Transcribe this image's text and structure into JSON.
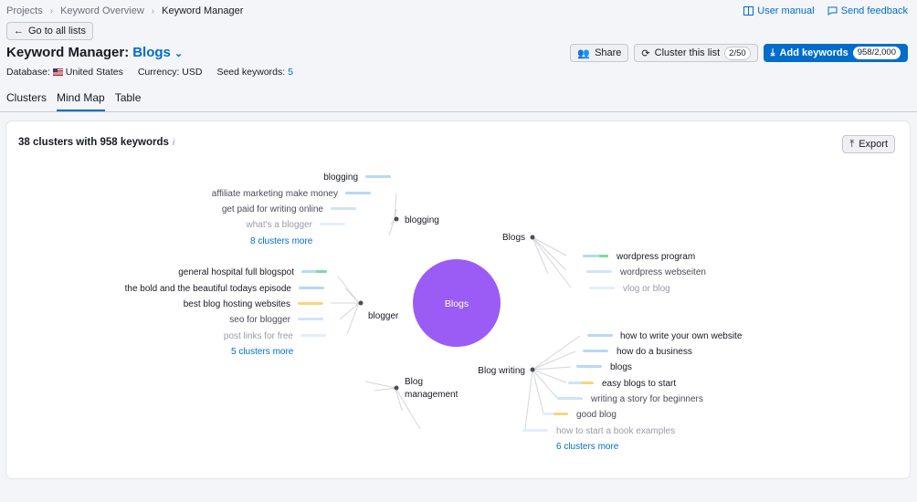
{
  "breadcrumb": {
    "items": [
      "Projects",
      "Keyword Overview",
      "Keyword Manager"
    ]
  },
  "toplinks": {
    "manual": "User manual",
    "feedback": "Send feedback"
  },
  "goto_label": "Go to all lists",
  "title": {
    "prefix": "Keyword Manager:",
    "list": "Blogs"
  },
  "meta": {
    "database_label": "Database:",
    "database_value": "United States",
    "currency_label": "Currency:",
    "currency_value": "USD",
    "seed_label": "Seed keywords:",
    "seed_value": "5"
  },
  "actions": {
    "share": "Share",
    "cluster": "Cluster this list",
    "cluster_count": "2/50",
    "add": "Add keywords",
    "add_count": "958/2,000"
  },
  "tabs": [
    "Clusters",
    "Mind Map",
    "Table"
  ],
  "card": {
    "title": "38 clusters with 958 keywords",
    "info": "i",
    "export": "Export"
  },
  "mindmap": {
    "center": "Blogs",
    "clusters": [
      {
        "name": "blogging",
        "keywords": [
          "blogging",
          "affiliate marketing make money",
          "get paid for writing online",
          "what's a blogger"
        ],
        "more": "8 clusters more"
      },
      {
        "name": "blogger",
        "keywords": [
          "general hospital full blogspot",
          "the bold and the beautiful todays episode",
          "best blog hosting websites",
          "seo for blogger",
          "post links for free"
        ],
        "more": "5 clusters more"
      },
      {
        "name": "Blog management",
        "line1": "Blog",
        "line2": "management",
        "keywords": []
      },
      {
        "name": "Blogs",
        "keywords": [
          "wordpress program",
          "wordpress webseiten",
          "vlog or blog"
        ]
      },
      {
        "name": "Blog writing",
        "keywords": [
          "how to write your own website",
          "how do a business",
          "blogs",
          "easy blogs to start",
          "writing a story for beginners",
          "good blog",
          "how to start a book examples"
        ],
        "more": "6 clusters more"
      }
    ]
  },
  "colors": {
    "accent": "#006dca",
    "center_node": "#9b5cf5",
    "bar_blue": "#b8d8f5",
    "bar_yellow": "#f5d67a",
    "bar_green": "#7ddb9c"
  }
}
